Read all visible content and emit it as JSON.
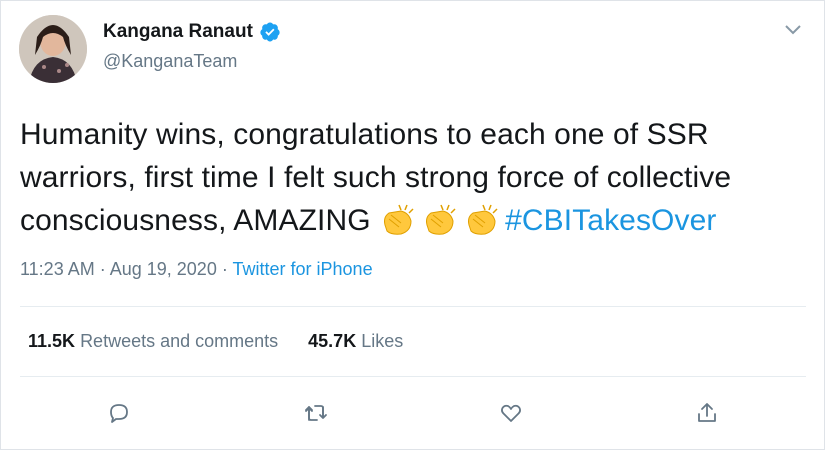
{
  "author": {
    "display_name": "Kangana Ranaut",
    "handle": "@KanganaTeam",
    "verified": true
  },
  "tweet": {
    "text_main": "Humanity wins, congratulations to each one of SSR warriors, first time I felt such strong force of collective consciousness, AMAZING ",
    "emoji_name": "clapping-hands",
    "emoji_count": 3,
    "hashtag": "#CBITakesOver"
  },
  "meta": {
    "time": "11:23 AM",
    "sep1": " · ",
    "date": "Aug 19, 2020",
    "sep2": " · ",
    "source": "Twitter for iPhone"
  },
  "stats": {
    "retweets_count": "11.5K",
    "retweets_label": "Retweets and comments",
    "likes_count": "45.7K",
    "likes_label": "Likes"
  },
  "actions": [
    "reply-icon",
    "retweet-icon",
    "like-icon",
    "share-icon"
  ],
  "colors": {
    "link": "#1b95e0",
    "secondary_text": "#657786",
    "primary_text": "#14171a",
    "verified_badge": "#1da1f2"
  }
}
